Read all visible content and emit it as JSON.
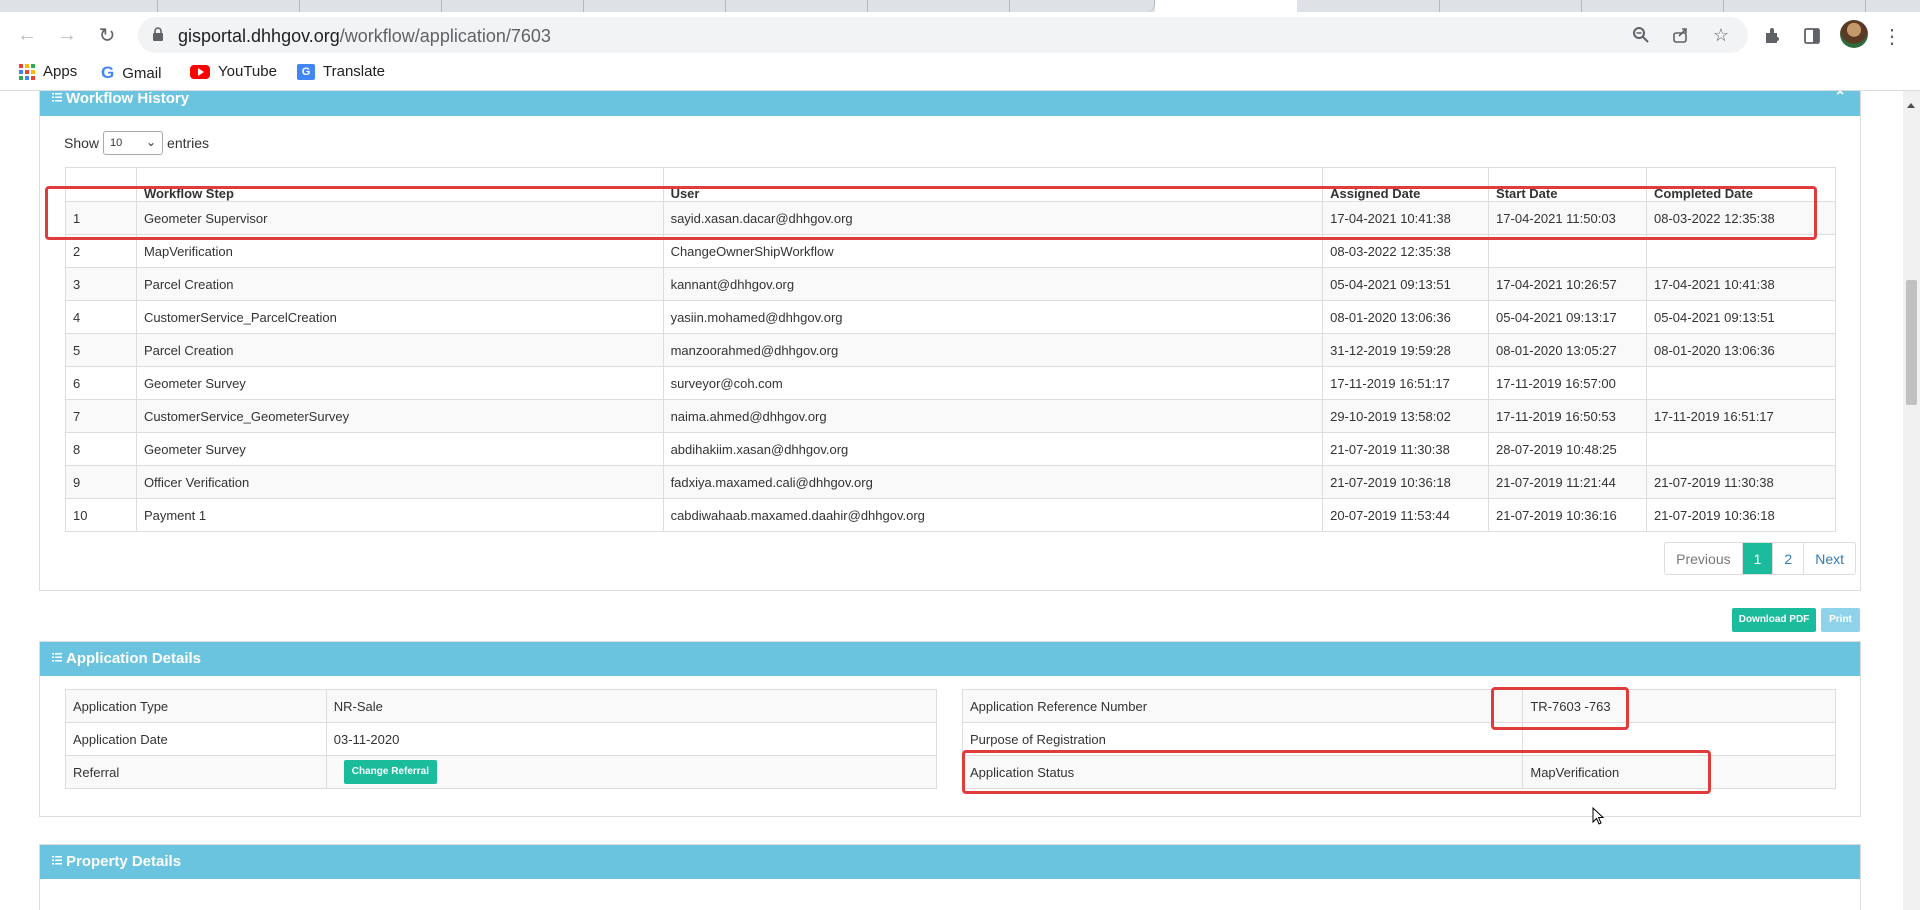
{
  "browser": {
    "url_host": "gisportal.dhhgov.org",
    "url_path": "/workflow/application/7603",
    "bookmarks": [
      {
        "label": "Apps",
        "icon": "apps-grid-icon"
      },
      {
        "label": "Gmail",
        "icon": "google-icon"
      },
      {
        "label": "YouTube",
        "icon": "youtube-icon"
      },
      {
        "label": "Translate",
        "icon": "translate-icon"
      }
    ]
  },
  "workflow": {
    "title": "Workflow History",
    "show_label": "Show",
    "entries_label": "entries",
    "page_size": "10",
    "columns": [
      "",
      "Workflow Step",
      "User",
      "Assigned Date",
      "Start Date",
      "Completed Date"
    ],
    "rows": [
      [
        "1",
        "Geometer Supervisor",
        "sayid.xasan.dacar@dhhgov.org",
        "17-04-2021 10:41:38",
        "17-04-2021 11:50:03",
        "08-03-2022 12:35:38"
      ],
      [
        "2",
        "MapVerification",
        "ChangeOwnerShipWorkflow",
        "08-03-2022 12:35:38",
        "",
        ""
      ],
      [
        "3",
        "Parcel Creation",
        "kannant@dhhgov.org",
        "05-04-2021 09:13:51",
        "17-04-2021 10:26:57",
        "17-04-2021 10:41:38"
      ],
      [
        "4",
        "CustomerService_ParcelCreation",
        "yasiin.mohamed@dhhgov.org",
        "08-01-2020 13:06:36",
        "05-04-2021 09:13:17",
        "05-04-2021 09:13:51"
      ],
      [
        "5",
        "Parcel Creation",
        "manzoorahmed@dhhgov.org",
        "31-12-2019 19:59:28",
        "08-01-2020 13:05:27",
        "08-01-2020 13:06:36"
      ],
      [
        "6",
        "Geometer Survey",
        "surveyor@coh.com",
        "17-11-2019 16:51:17",
        "17-11-2019 16:57:00",
        ""
      ],
      [
        "7",
        "CustomerService_GeometerSurvey",
        "naima.ahmed@dhhgov.org",
        "29-10-2019 13:58:02",
        "17-11-2019 16:50:53",
        "17-11-2019 16:51:17"
      ],
      [
        "8",
        "Geometer Survey",
        "abdihakiim.xasan@dhhgov.org",
        "21-07-2019 11:30:38",
        "28-07-2019 10:48:25",
        ""
      ],
      [
        "9",
        "Officer Verification",
        "fadxiya.maxamed.cali@dhhgov.org",
        "21-07-2019 10:36:18",
        "21-07-2019 11:21:44",
        "21-07-2019 11:30:38"
      ],
      [
        "10",
        "Payment 1",
        "cabdiwahaab.maxamed.daahir@dhhgov.org",
        "20-07-2019 11:53:44",
        "21-07-2019 10:36:16",
        "21-07-2019 10:36:18"
      ]
    ],
    "pager": {
      "previous": "Previous",
      "current": "1",
      "page2": "2",
      "next": "Next"
    }
  },
  "actions": {
    "download_pdf": "Download PDF",
    "print": "Print"
  },
  "application": {
    "title": "Application Details",
    "type_label": "Application Type",
    "type_value": "NR-Sale",
    "date_label": "Application Date",
    "date_value": "03-11-2020",
    "referral_label": "Referral",
    "change_referral": "Change Referral",
    "ref_label": "Application Reference Number",
    "ref_value": "TR-7603 -763",
    "purpose_label": "Purpose of Registration",
    "purpose_value": "",
    "status_label": "Application Status",
    "status_value": "MapVerification"
  },
  "property": {
    "title": "Property Details"
  },
  "colors": {
    "panel_header": "#6ac4df",
    "accent_green": "#1abc9c",
    "highlight_red": "#e03c3c"
  }
}
